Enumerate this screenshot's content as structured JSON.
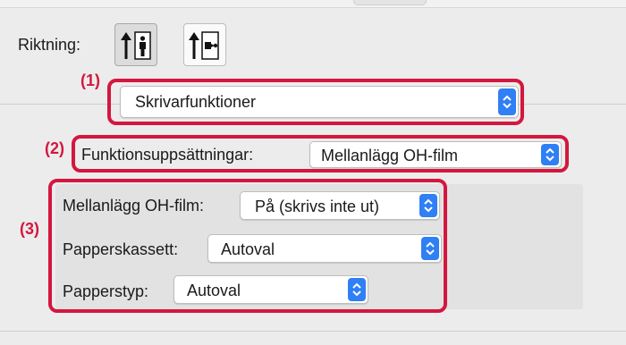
{
  "orientation": {
    "label": "Riktning:",
    "buttons": [
      {
        "name": "portrait",
        "selected": true
      },
      {
        "name": "landscape",
        "selected": false
      }
    ]
  },
  "markers": [
    "(1)",
    "(2)",
    "(3)"
  ],
  "printer_functions": {
    "value": "Skrivarfunktioner"
  },
  "feature_sets": {
    "label": "Funktionsuppsättningar:",
    "value": "Mellanlägg OH-film"
  },
  "options": [
    {
      "label": "Mellanlägg OH-film:",
      "value": "På (skrivs inte ut)"
    },
    {
      "label": "Papperskassett:",
      "value": "Autoval"
    },
    {
      "label": "Papperstyp:",
      "value": "Autoval"
    }
  ],
  "colors": {
    "highlight": "#d3173f",
    "stepper": "#2f7ff5"
  }
}
